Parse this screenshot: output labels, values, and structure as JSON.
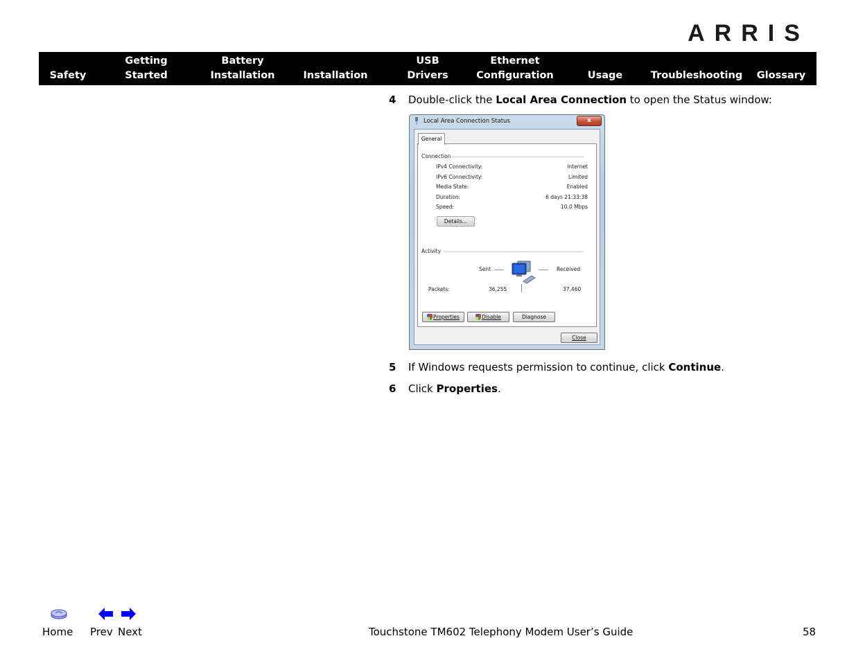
{
  "brand": {
    "logo_text": "ARRIS"
  },
  "nav": {
    "items": [
      {
        "line1": "",
        "line2": "Safety"
      },
      {
        "line1": "Getting",
        "line2": "Started"
      },
      {
        "line1": "Battery",
        "line2": "Installation"
      },
      {
        "line1": "",
        "line2": "Installation"
      },
      {
        "line1": "USB",
        "line2": "Drivers"
      },
      {
        "line1": "Ethernet",
        "line2": "Configuration"
      },
      {
        "line1": "",
        "line2": "Usage"
      },
      {
        "line1": "",
        "line2": "Troubleshooting"
      },
      {
        "line1": "",
        "line2": "Glossary"
      }
    ]
  },
  "steps": [
    {
      "num": "4",
      "pre": "Double-click the ",
      "bold": "Local Area Connection",
      "post": " to open the Status window:"
    },
    {
      "num": "5",
      "pre": "If Windows requests permission to continue, click ",
      "bold": "Continue",
      "post": "."
    },
    {
      "num": "6",
      "pre": "Click ",
      "bold": "Properties",
      "post": "."
    }
  ],
  "dialog": {
    "title": "Local Area Connection Status",
    "close_glyph": "x",
    "tab": "General",
    "connection_label": "Connection",
    "rows": [
      {
        "label": "IPv4 Connectivity:",
        "value": "Internet"
      },
      {
        "label": "IPv6 Connectivity:",
        "value": "Limited"
      },
      {
        "label": "Media State:",
        "value": "Enabled"
      },
      {
        "label": "Duration:",
        "value": "6 days 21:33:38"
      },
      {
        "label": "Speed:",
        "value": "10.0 Mbps"
      }
    ],
    "details_button": "Details...",
    "activity_label": "Activity",
    "sent_label": "Sent",
    "received_label": "Received",
    "packets_label": "Packets:",
    "packets_sent": "36,255",
    "packets_received": "37,460",
    "properties_button": "Properties",
    "disable_button": "Disable",
    "diagnose_button": "Diagnose",
    "close_button": "Close"
  },
  "footer": {
    "home_label": "Home",
    "prev_label": "Prev",
    "next_label": "Next",
    "title": "Touchstone TM602 Telephony Modem User’s Guide",
    "page_number": "58",
    "icon_color": "#0000ff"
  }
}
